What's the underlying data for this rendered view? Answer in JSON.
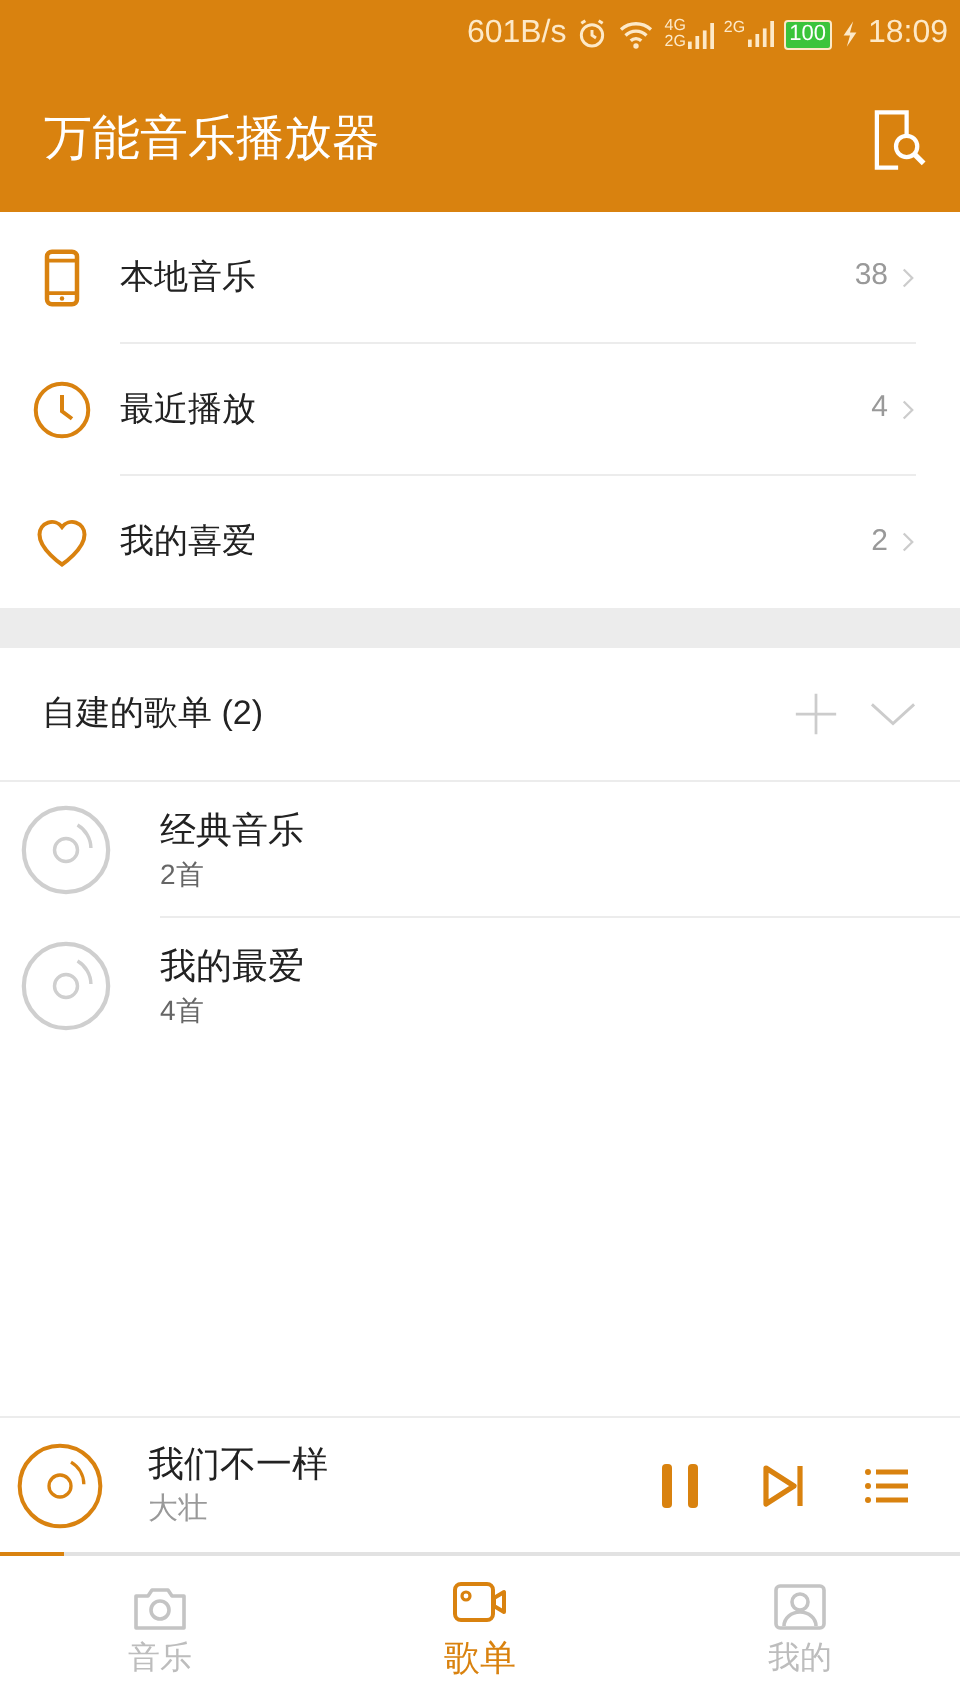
{
  "status_bar": {
    "speed": "601B/s",
    "network_top": "4G",
    "network_bottom": "2G",
    "network_2": "2G",
    "battery": "100",
    "charging": true,
    "time": "18:09"
  },
  "app_bar": {
    "title": "万能音乐播放器"
  },
  "library": [
    {
      "kind": "phone",
      "label": "本地音乐",
      "count": "38"
    },
    {
      "kind": "clock",
      "label": "最近播放",
      "count": "4"
    },
    {
      "kind": "heart",
      "label": "我的喜爱",
      "count": "2"
    }
  ],
  "playlists_section": {
    "title": "自建的歌单 (2)",
    "expanded": true
  },
  "playlists": [
    {
      "name": "经典音乐",
      "count": "2首"
    },
    {
      "name": "我的最爱",
      "count": "4首"
    }
  ],
  "now_playing": {
    "title": "我们不一样",
    "artist": "大壮",
    "playing": true,
    "level": 0.067
  },
  "tabs": [
    {
      "kind": "camera",
      "label": "音乐",
      "selected": false
    },
    {
      "kind": "video",
      "label": "歌单",
      "selected": true
    },
    {
      "kind": "person",
      "label": "我的",
      "selected": false
    }
  ]
}
